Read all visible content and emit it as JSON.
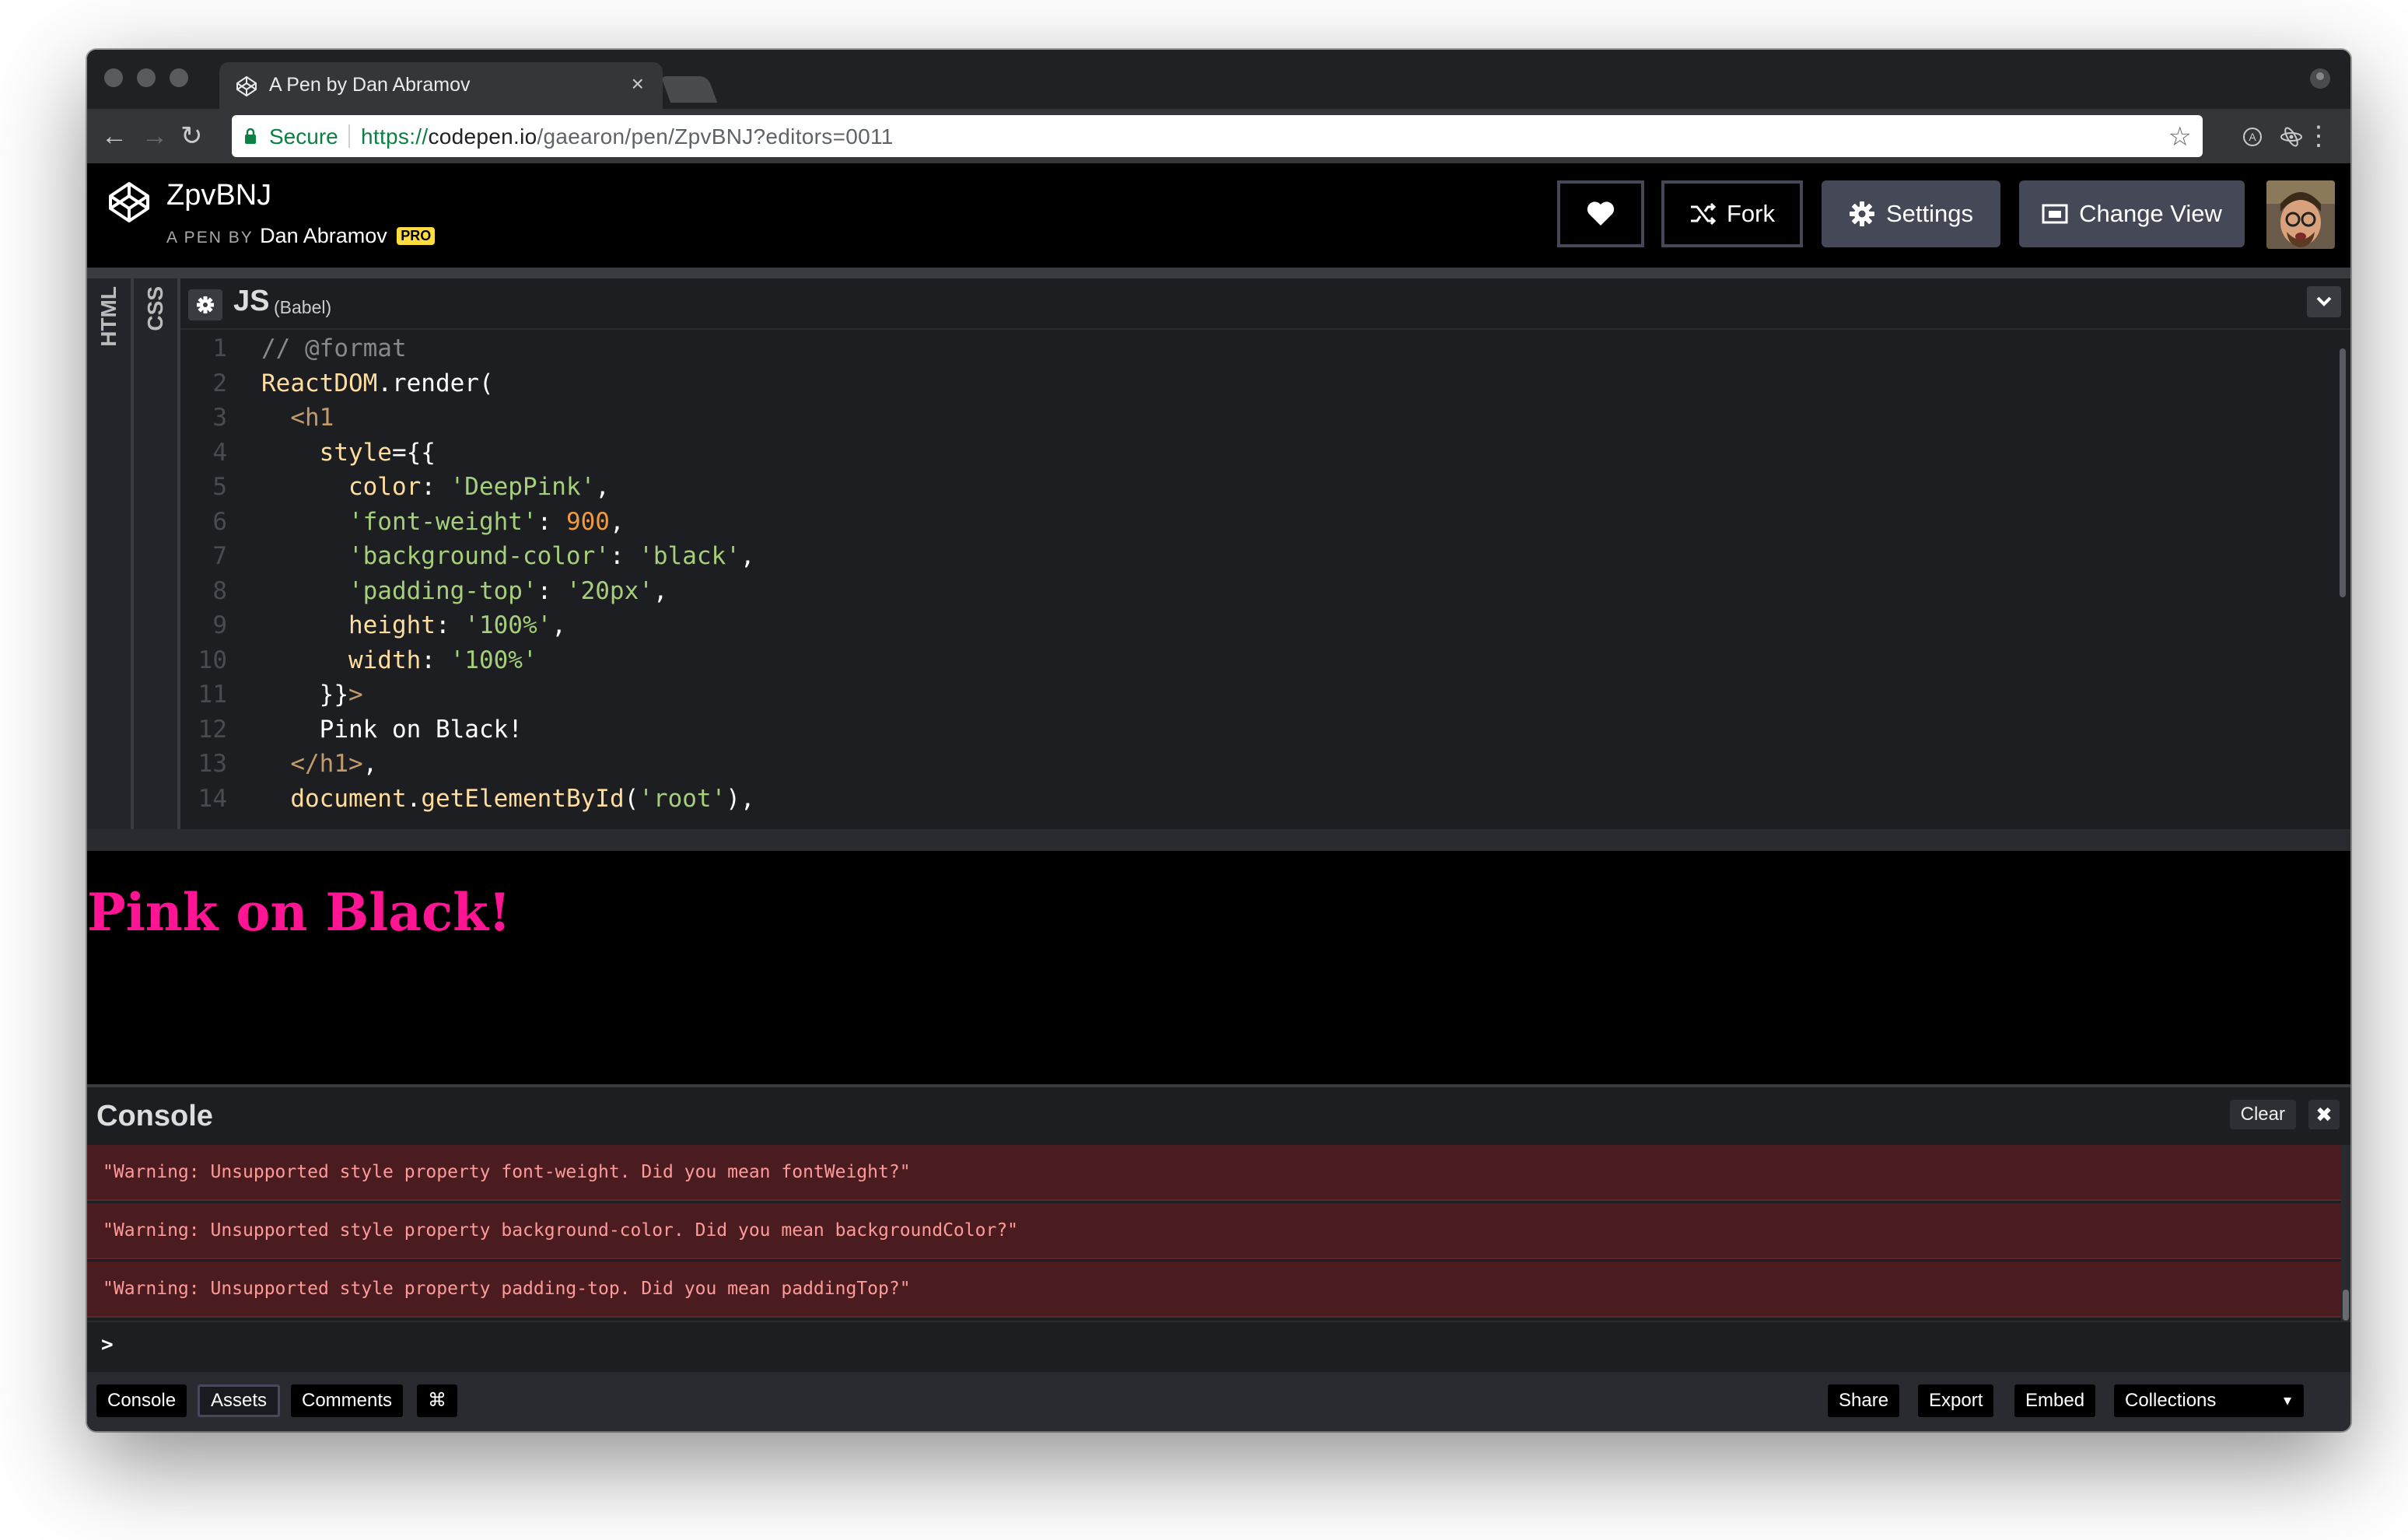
{
  "browser": {
    "tab_title": "A Pen by Dan Abramov",
    "tab_close": "×",
    "secure_label": "Secure",
    "url_scheme": "https://",
    "url_host": "codepen.io",
    "url_path": "/gaearon/pen/ZpvBNJ?editors=0011",
    "nav_back": "←",
    "nav_forward": "→",
    "nav_reload": "↻",
    "star": "☆",
    "menu": "⋮"
  },
  "header": {
    "pen_title": "ZpvBNJ",
    "by_label": "A PEN BY",
    "author": "Dan Abramov",
    "pro_badge": "PRO",
    "heart_icon": "heart-icon",
    "fork_label": "Fork",
    "settings_label": "Settings",
    "change_view_label": "Change View"
  },
  "editor": {
    "side_tabs": [
      "HTML",
      "CSS"
    ],
    "language": "JS",
    "preprocessor": "(Babel)",
    "line_numbers": [
      "1",
      "2",
      "3",
      "4",
      "5",
      "6",
      "7",
      "8",
      "9",
      "10",
      "11",
      "12",
      "13",
      "14"
    ],
    "lines": [
      [
        {
          "t": "// @format",
          "c": "comment"
        }
      ],
      [
        {
          "t": "ReactDOM",
          "c": "obj"
        },
        {
          "t": ".render(",
          "c": "plain"
        }
      ],
      [
        {
          "t": "  <h1",
          "c": "tag"
        }
      ],
      [
        {
          "t": "    style",
          "c": "attr"
        },
        {
          "t": "={{",
          "c": "plain"
        }
      ],
      [
        {
          "t": "      color",
          "c": "attr"
        },
        {
          "t": ": ",
          "c": "plain"
        },
        {
          "t": "'DeepPink'",
          "c": "str"
        },
        {
          "t": ",",
          "c": "plain"
        }
      ],
      [
        {
          "t": "      'font-weight'",
          "c": "str"
        },
        {
          "t": ": ",
          "c": "plain"
        },
        {
          "t": "900",
          "c": "num"
        },
        {
          "t": ",",
          "c": "plain"
        }
      ],
      [
        {
          "t": "      'background-color'",
          "c": "str"
        },
        {
          "t": ": ",
          "c": "plain"
        },
        {
          "t": "'black'",
          "c": "str"
        },
        {
          "t": ",",
          "c": "plain"
        }
      ],
      [
        {
          "t": "      'padding-top'",
          "c": "str"
        },
        {
          "t": ": ",
          "c": "plain"
        },
        {
          "t": "'20px'",
          "c": "str"
        },
        {
          "t": ",",
          "c": "plain"
        }
      ],
      [
        {
          "t": "      height",
          "c": "attr"
        },
        {
          "t": ": ",
          "c": "plain"
        },
        {
          "t": "'100%'",
          "c": "str"
        },
        {
          "t": ",",
          "c": "plain"
        }
      ],
      [
        {
          "t": "      width",
          "c": "attr"
        },
        {
          "t": ": ",
          "c": "plain"
        },
        {
          "t": "'100%'",
          "c": "str"
        }
      ],
      [
        {
          "t": "    }}",
          "c": "plain"
        },
        {
          "t": ">",
          "c": "tag"
        }
      ],
      [
        {
          "t": "    Pink on Black!",
          "c": "plain"
        }
      ],
      [
        {
          "t": "  </h1>",
          "c": "tag"
        },
        {
          "t": ",",
          "c": "plain"
        }
      ],
      [
        {
          "t": "  document",
          "c": "obj"
        },
        {
          "t": ".",
          "c": "plain"
        },
        {
          "t": "getElementById",
          "c": "fn"
        },
        {
          "t": "(",
          "c": "plain"
        },
        {
          "t": "'root'",
          "c": "str"
        },
        {
          "t": "),",
          "c": "plain"
        }
      ]
    ]
  },
  "preview": {
    "heading": "Pink on Black!"
  },
  "console": {
    "title": "Console",
    "clear_label": "Clear",
    "close_label": "✖",
    "messages": [
      "\"Warning: Unsupported style property font-weight. Did you mean fontWeight?\"",
      "\"Warning: Unsupported style property background-color. Did you mean backgroundColor?\"",
      "\"Warning: Unsupported style property padding-top. Did you mean paddingTop?\""
    ],
    "prompt": ">"
  },
  "footer": {
    "console_label": "Console",
    "assets_label": "Assets",
    "comments_label": "Comments",
    "shortcut_label": "⌘",
    "share_label": "Share",
    "export_label": "Export",
    "embed_label": "Embed",
    "collections_label": "Collections",
    "collections_caret": "▾"
  },
  "colors": {
    "preview_text": "#ff1493",
    "pro_badge": "#ffdd40",
    "secure_green": "#0b8043",
    "warning_bg": "#4b1c1f"
  }
}
